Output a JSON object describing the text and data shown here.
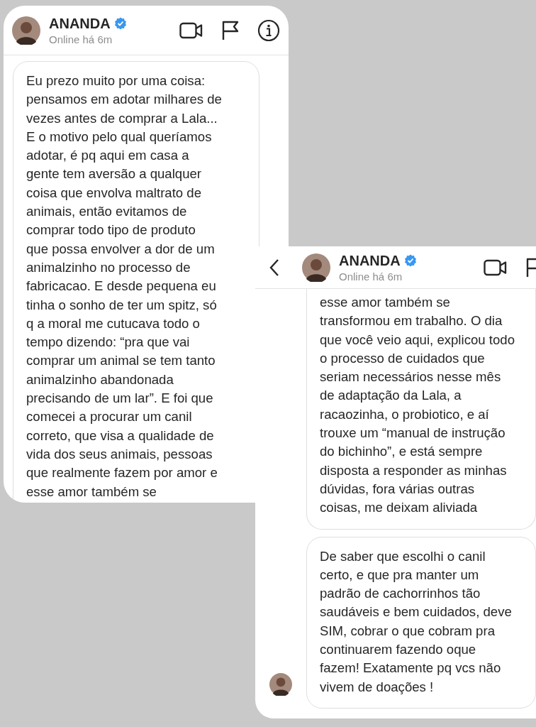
{
  "screens": [
    {
      "header": {
        "back": false,
        "name": "ANANDA",
        "verified": true,
        "status": "Online há 6m",
        "actions": [
          {
            "kind": "video"
          },
          {
            "kind": "flag"
          },
          {
            "kind": "info"
          }
        ]
      },
      "messages": [
        {
          "text": "Eu prezo muito por uma coisa:\npensamos em adotar milhares de\nvezes antes de comprar a Lala...\nE o motivo pelo qual queríamos\nadotar, é pq aqui em casa a\ngente tem aversão a qualquer\ncoisa que envolva maltrato de\nanimais, então evitamos de\ncomprar todo tipo de produto\nque possa envolver a dor de um\nanimalzinho no processo de\nfabricacao. E desde pequena eu\ntinha o sonho de ter um spitz, só\nq a moral me cutucava todo o\ntempo dizendo: “pra que vai\ncomprar um animal se tem tanto\nanimalzinho abandonada\nprecisando de um lar”. E foi que\ncomecei a procurar um canil\ncorreto, que visa a qualidade de\nvida dos seus animais, pessoas\nque realmente fazem por amor e\nesse amor também se",
          "continued": false,
          "avatar": false
        }
      ]
    },
    {
      "header": {
        "back": true,
        "name": "ANANDA",
        "verified": true,
        "status": "Online há 6m",
        "actions": [
          {
            "kind": "video"
          },
          {
            "kind": "flag"
          }
        ]
      },
      "messages": [
        {
          "text": "esse amor também se\ntransformou em trabalho. O dia\nque você veio aqui, explicou todo\no processo de cuidados que\nseriam necessários nesse mês\nde adaptação da Lala, a\nracaozinha, o probiotico, e aí\ntrouxe um “manual de instrução\ndo bichinho”, e está sempre\ndisposta a responder as minhas\ndúvidas, fora várias outras\ncoisas, me deixam aliviada",
          "continued": true,
          "avatar": false
        },
        {
          "text": "De saber que escolhi o canil\ncerto, e que pra manter um\npadrão de cachorrinhos tão\nsaudáveis e bem cuidados, deve\nSIM, cobrar o que cobram pra\ncontinuarem fazendo oque\nfazem! Exatamente pq vcs não\nvivem de doações !",
          "continued": false,
          "avatar": true
        }
      ]
    }
  ]
}
